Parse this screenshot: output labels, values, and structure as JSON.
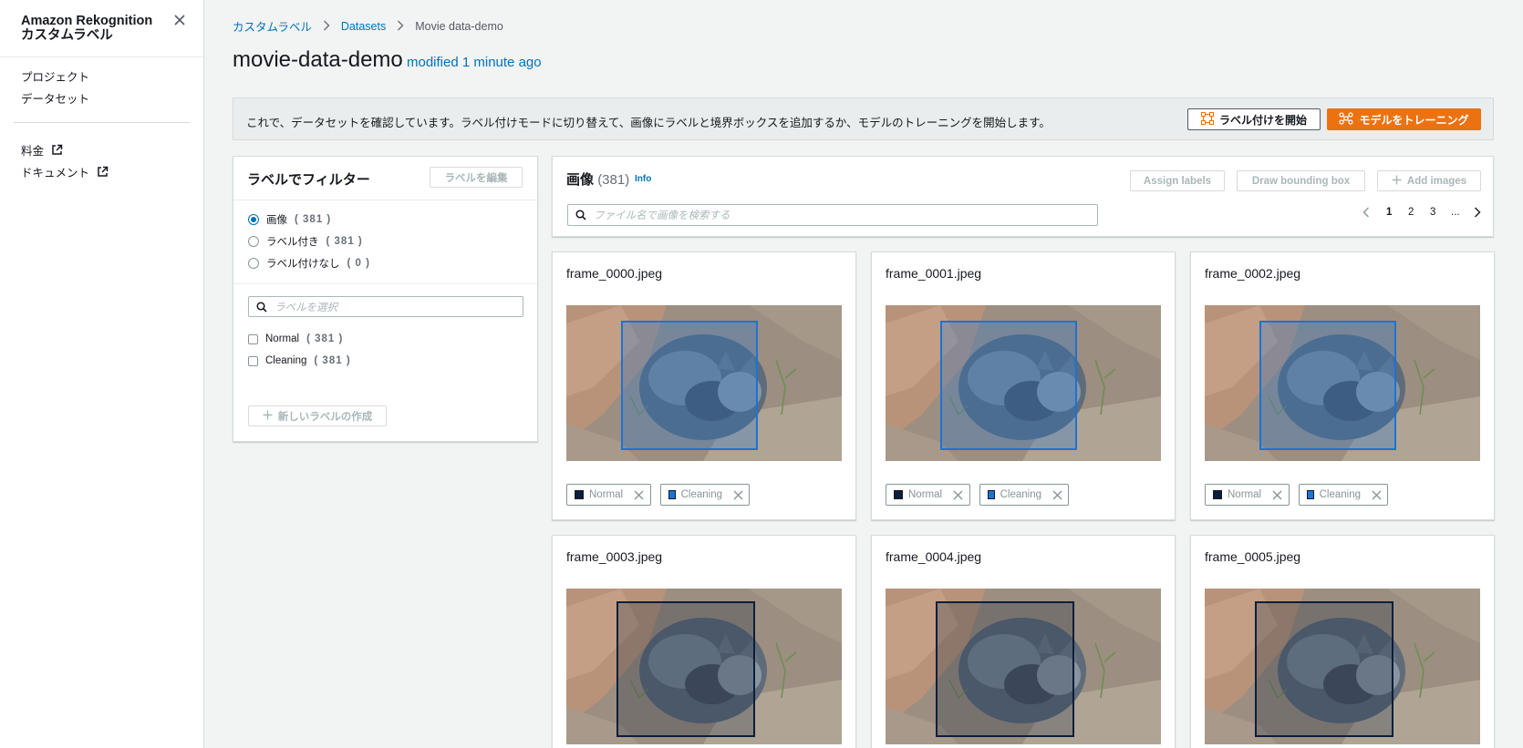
{
  "sidebar": {
    "title": "Amazon Rekognition カスタムラベル",
    "nav": [
      {
        "label": "プロジェクト"
      },
      {
        "label": "データセット"
      }
    ],
    "links": [
      {
        "label": "料金"
      },
      {
        "label": "ドキュメント"
      }
    ]
  },
  "breadcrumb": {
    "items": [
      "カスタムラベル",
      "Datasets"
    ],
    "current": "Movie data-demo"
  },
  "page": {
    "title": "movie-data-demo",
    "modified": "modified 1 minute ago"
  },
  "banner": {
    "text": "これで、データセットを確認しています。ラベル付けモードに切り替えて、画像にラベルと境界ボックスを追加するか、モデルのトレーニングを開始します。",
    "start_labeling": "ラベル付けを開始",
    "train_model": "モデルをトレーニング"
  },
  "filter": {
    "title": "ラベルでフィルター",
    "edit_labels": "ラベルを編集",
    "radios": [
      {
        "label": "画像",
        "count": "( 381 )",
        "selected": true
      },
      {
        "label": "ラベル付き",
        "count": "( 381 )",
        "selected": false
      },
      {
        "label": "ラベル付けなし",
        "count": "( 0 )",
        "selected": false
      }
    ],
    "label_search_placeholder": "ラベルを選択",
    "labels": [
      {
        "label": "Normal",
        "count": "( 381 )"
      },
      {
        "label": "Cleaning",
        "count": "( 381 )"
      }
    ],
    "create_label": "新しいラベルの作成"
  },
  "images": {
    "title": "画像",
    "count": "(381)",
    "info": "Info",
    "assign_labels": "Assign labels",
    "draw_bbox": "Draw bounding box",
    "add_images": "Add images",
    "search_placeholder": "ファイル名で画像を検索する",
    "pages": [
      "1",
      "2",
      "3",
      "..."
    ],
    "current_page": "1"
  },
  "cards": [
    {
      "name": "frame_0000.jpeg",
      "tags": [
        "Normal",
        "Cleaning"
      ]
    },
    {
      "name": "frame_0001.jpeg",
      "tags": [
        "Normal",
        "Cleaning"
      ]
    },
    {
      "name": "frame_0002.jpeg",
      "tags": [
        "Normal",
        "Cleaning"
      ]
    },
    {
      "name": "frame_0003.jpeg",
      "tags": []
    },
    {
      "name": "frame_0004.jpeg",
      "tags": []
    },
    {
      "name": "frame_0005.jpeg",
      "tags": []
    }
  ],
  "colors": {
    "link": "#0073bb",
    "primary": "#ec7211",
    "normal_swatch": "#0b1f3b",
    "cleaning_swatch": "#1a73d8",
    "bbox_cleaning": "#1a73d8",
    "bbox_normal": "#0b1f3b"
  }
}
